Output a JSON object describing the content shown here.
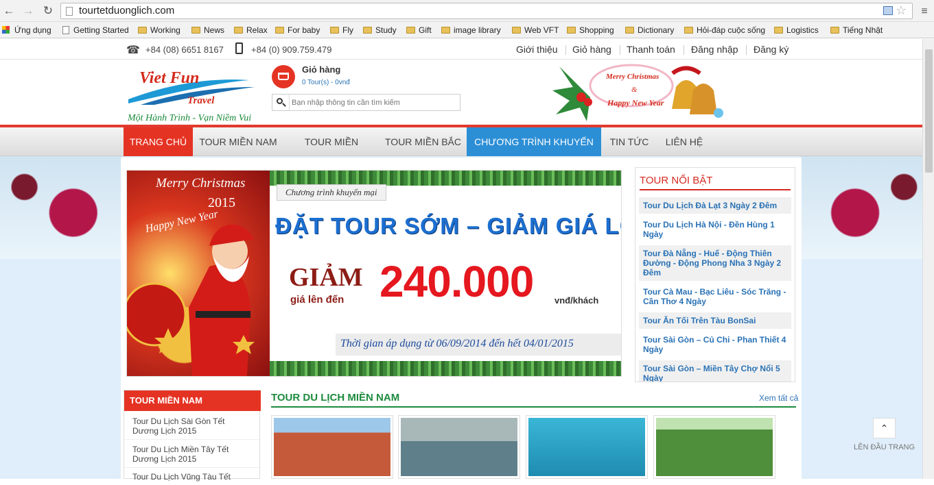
{
  "browser": {
    "url": "tourtetduonglich.com",
    "bookmarks": [
      "Ứng dụng",
      "Getting Started",
      "Working",
      "News",
      "Relax",
      "For baby",
      "Fly",
      "Study",
      "Gift",
      "image library",
      "Web VFT",
      "Shopping",
      "Dictionary",
      "Hỏi-đáp cuộc sống",
      "Logistics",
      "Tiếng Nhật"
    ]
  },
  "topbar": {
    "phone1": "+84 (08) 6651 8167",
    "phone2": "+84 (0) 909.759.479",
    "links": [
      "Giới thiệu",
      "Giỏ hàng",
      "Thanh toán",
      "Đăng nhập",
      "Đăng ký"
    ]
  },
  "header": {
    "logo_title1": "Viet Fun",
    "logo_title2": "Travel",
    "logo_slogan": "Một Hành Trình - Vạn Niềm Vui",
    "cart_title": "Giỏ hàng",
    "cart_info": "0 Tour(s) - 0vnđ",
    "search_placeholder": "Bạn nhập thông tin cần tìm kiếm",
    "xmas_line1": "Merry Christmas",
    "xmas_line2": "&",
    "xmas_line3": "Happy New Year"
  },
  "menu": [
    "TRANG CHỦ",
    "TOUR MIỀN NAM",
    "TOUR MIỀN TRUNG",
    "TOUR MIỀN BẮC",
    "CHƯƠNG TRÌNH KHUYẾN MẠI",
    "TIN TỨC",
    "LIÊN HỆ"
  ],
  "banner": {
    "left_line1": "Merry Christmas",
    "left_year": "2015",
    "left_line2": "Happy New Year",
    "tag": "Chương trình khuyến mại",
    "headline": "ĐẶT TOUR SỚM – GIẢM GIÁ LỚN",
    "discount_word": "GIẢM",
    "discount_sub": "giá lên đến",
    "amount": "240.000",
    "unit": "vnđ/khách",
    "period": "Thời gian áp dụng từ 06/09/2014 đến hết 04/01/2015"
  },
  "featured": {
    "title": "TOUR NỔI BẬT",
    "items": [
      "Tour Du Lịch Đà Lạt 3 Ngày 2 Đêm",
      "Tour Du Lịch Hà Nội - Đền Hùng 1 Ngày",
      "Tour Đà Nẵng - Huế - Động Thiên Đường - Động Phong Nha 3 Ngày 2 Đêm",
      "Tour Cà Mau - Bạc Liêu - Sóc Trăng - Cần Thơ 4 Ngày",
      "Tour Ăn Tối Trên Tàu BonSai",
      "Tour Sài Gòn – Củ Chi - Phan Thiết 4 Ngày",
      "Tour Sài Gòn – Miền Tây Chợ Nổi 5 Ngày"
    ]
  },
  "sidebar": {
    "title": "TOUR MIỀN NAM",
    "items": [
      "Tour Du Lịch Sài Gòn Tết Dương Lịch 2015",
      "Tour Du Lịch Miền Tây Tết Dương Lịch 2015",
      "Tour Du Lịch Vũng Tàu Tết"
    ]
  },
  "section": {
    "title": "TOUR DU LỊCH MIỀN NAM",
    "view_all": "Xem tất cả"
  },
  "totop_label": "LÊN ĐẦU TRANG"
}
